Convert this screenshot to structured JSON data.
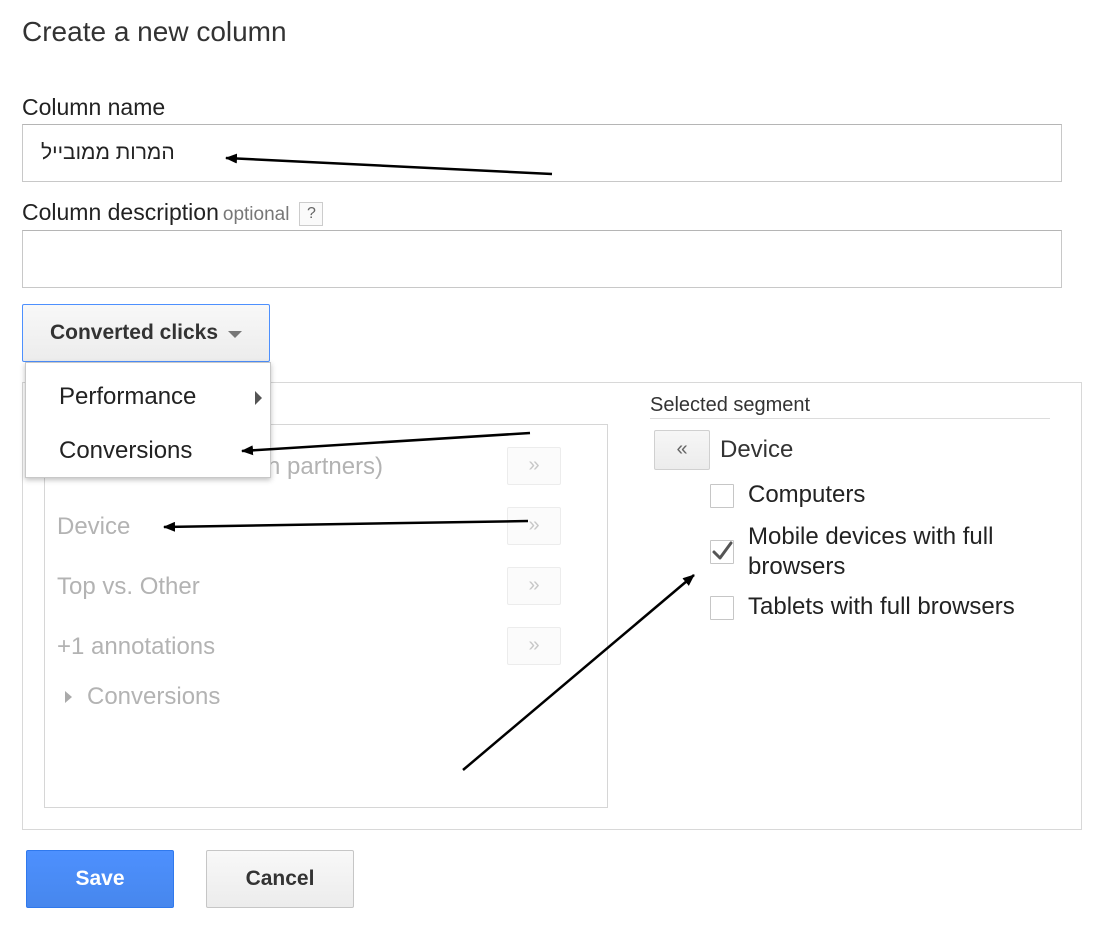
{
  "dialog": {
    "title": "Create a new column",
    "column_name": {
      "label": "Column name",
      "value": "המרות ממובייל"
    },
    "column_description": {
      "label": "Column description",
      "optional": "optional",
      "help": "?",
      "value": ""
    }
  },
  "metric_dropdown": {
    "label": "Converted clicks",
    "icon": "chevron-down-icon"
  },
  "dropdown_menu": {
    "items": [
      "Performance",
      "Conversions"
    ],
    "submenu_icon": "triangle-right-icon"
  },
  "available_segments": {
    "items": [
      {
        "label": "ch partners)",
        "button": "»"
      },
      {
        "label": "Device",
        "button": "»"
      },
      {
        "label": "Top vs. Other",
        "button": "»"
      },
      {
        "label": "+1 annotations",
        "button": "»"
      }
    ],
    "group": {
      "label": "Conversions",
      "icon": "triangle-right-icon"
    }
  },
  "selected_segment": {
    "heading": "Selected segment",
    "remove_button": "«",
    "name": "Device",
    "options": [
      {
        "label": "Computers",
        "checked": false
      },
      {
        "label": "Mobile devices with full browsers",
        "checked": true
      },
      {
        "label": "Tablets with full browsers",
        "checked": false
      }
    ]
  },
  "actions": {
    "save": "Save",
    "cancel": "Cancel"
  },
  "colors": {
    "accent": "#4d90fe",
    "save_border": "#3079ed",
    "annotation_arrow": "#000000"
  }
}
